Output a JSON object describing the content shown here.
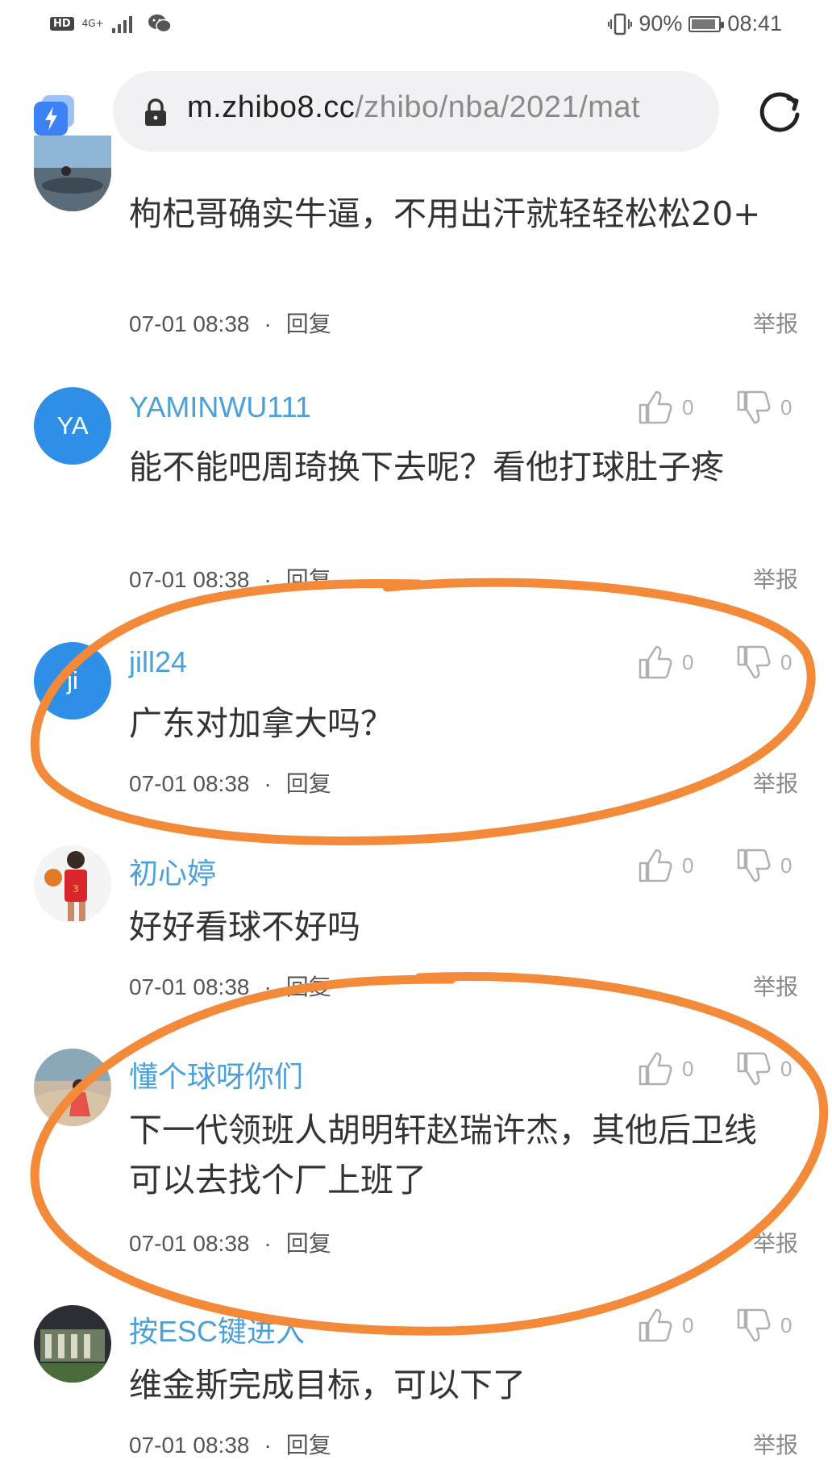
{
  "status_bar": {
    "hd_label": "HD",
    "network": "4G+",
    "battery": "90%",
    "battery_level": 0.9,
    "time": "08:41"
  },
  "browser": {
    "url_host": "m.zhibo8.cc",
    "url_path": "/zhibo/nba/2021/mat",
    "app_icon": "lightning-app-icon",
    "lock_icon": "lock-icon",
    "reload_icon": "reload-icon",
    "accent_color": "#3b82f6"
  },
  "comments": [
    {
      "username": "",
      "text": "枸杞哥确实牛逼，不用出汗就轻轻松松20+",
      "time": "07-01 08:38",
      "reply": "回复",
      "report": "举报"
    },
    {
      "avatar_text": "YA",
      "username": "YAMINWU111",
      "likes": "0",
      "dislikes": "0",
      "text": "能不能吧周琦换下去呢？看他打球肚子疼",
      "time": "07-01 08:38",
      "reply": "回复",
      "report": "举报"
    },
    {
      "avatar_text": "ji",
      "username": "jill24",
      "likes": "0",
      "dislikes": "0",
      "text": "广东对加拿大吗？",
      "time": "07-01 08:38",
      "reply": "回复",
      "report": "举报"
    },
    {
      "username": "初心婷",
      "likes": "0",
      "dislikes": "0",
      "text": "好好看球不好吗",
      "time": "07-01 08:38",
      "reply": "回复",
      "report": "举报"
    },
    {
      "username": "懂个球呀你们",
      "likes": "0",
      "dislikes": "0",
      "text": "下一代领班人胡明轩赵瑞许杰，其他后卫线可以去找个厂上班了",
      "time": "07-01 08:38",
      "reply": "回复",
      "report": "举报"
    },
    {
      "username": "按ESC键进入",
      "likes": "0",
      "dislikes": "0",
      "text": "维金斯完成目标，可以下了",
      "time": "07-01 08:38",
      "reply": "回复",
      "report": "举报"
    }
  ],
  "colors": {
    "username": "#4ba0d8",
    "avatar_blue": "#2f8fe6",
    "annotation": "#f28a3a"
  }
}
